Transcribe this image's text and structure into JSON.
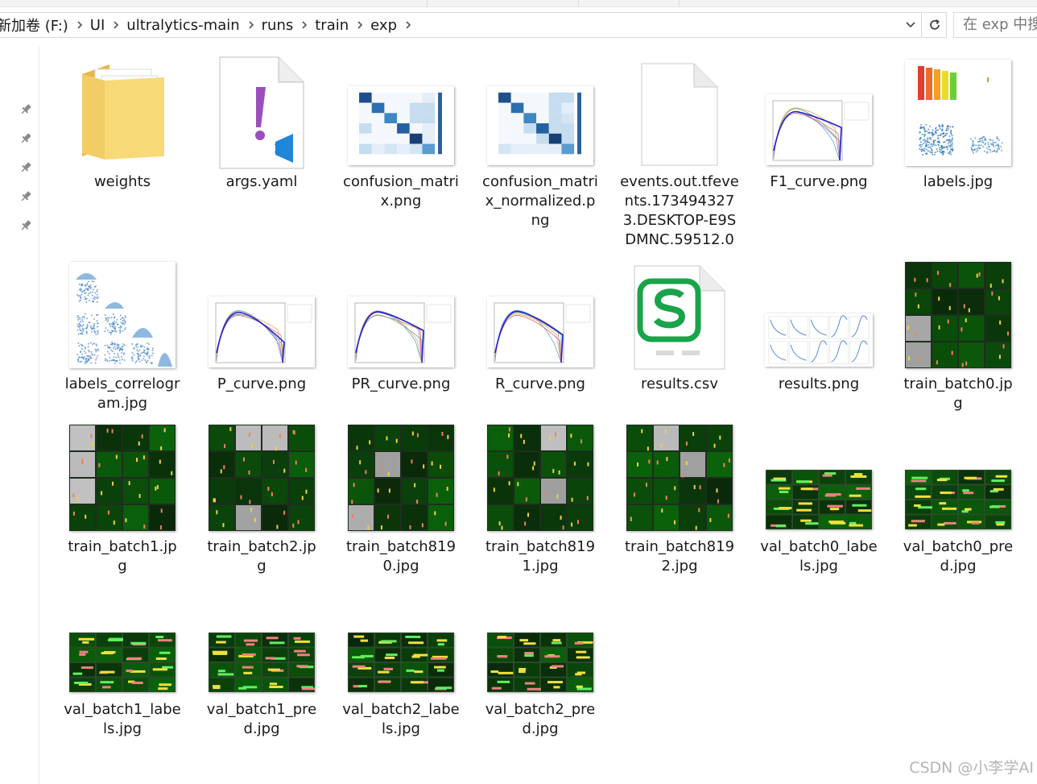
{
  "window": {
    "breadcrumb": [
      "新加卷 (F:)",
      "UI",
      "ultralytics-main",
      "runs",
      "train",
      "exp"
    ],
    "search_placeholder": "在 exp 中搜"
  },
  "nav": {
    "pins": [
      "pin-icon",
      "pin-icon",
      "pin-icon",
      "pin-icon",
      "pin-icon"
    ]
  },
  "files": [
    {
      "name": "weights",
      "type": "folder",
      "icon": "folder-icon"
    },
    {
      "name": "args.yaml",
      "type": "yaml",
      "icon": "vscode-yaml-icon"
    },
    {
      "name": "confusion_matrix.png",
      "type": "image",
      "icon": "confusion-matrix-thumb"
    },
    {
      "name": "confusion_matrix_normalized.png",
      "type": "image",
      "icon": "confusion-matrix-thumb"
    },
    {
      "name": "events.out.tfevents.1734943273.DESKTOP-E9SDMNC.59512.0",
      "type": "file",
      "icon": "blank-file-icon"
    },
    {
      "name": "F1_curve.png",
      "type": "image",
      "icon": "curve-thumb"
    },
    {
      "name": "labels.jpg",
      "type": "image",
      "icon": "labels-thumb"
    },
    {
      "name": "labels_correlogram.jpg",
      "type": "image",
      "icon": "correlogram-thumb"
    },
    {
      "name": "P_curve.png",
      "type": "image",
      "icon": "curve-thumb"
    },
    {
      "name": "PR_curve.png",
      "type": "image",
      "icon": "curve-thumb"
    },
    {
      "name": "R_curve.png",
      "type": "image",
      "icon": "curve-thumb"
    },
    {
      "name": "results.csv",
      "type": "csv",
      "icon": "wps-spreadsheet-icon"
    },
    {
      "name": "results.png",
      "type": "image",
      "icon": "results-thumb"
    },
    {
      "name": "train_batch0.jpg",
      "type": "image",
      "icon": "mosaic-thumb"
    },
    {
      "name": "train_batch1.jpg",
      "type": "image",
      "icon": "mosaic-thumb"
    },
    {
      "name": "train_batch2.jpg",
      "type": "image",
      "icon": "mosaic-thumb"
    },
    {
      "name": "train_batch8190.jpg",
      "type": "image",
      "icon": "mosaic-thumb"
    },
    {
      "name": "train_batch8191.jpg",
      "type": "image",
      "icon": "mosaic-thumb"
    },
    {
      "name": "train_batch8192.jpg",
      "type": "image",
      "icon": "mosaic-thumb"
    },
    {
      "name": "val_batch0_labels.jpg",
      "type": "image",
      "icon": "val-thumb"
    },
    {
      "name": "val_batch0_pred.jpg",
      "type": "image",
      "icon": "val-thumb"
    },
    {
      "name": "val_batch1_labels.jpg",
      "type": "image",
      "icon": "val-thumb"
    },
    {
      "name": "val_batch1_pred.jpg",
      "type": "image",
      "icon": "val-thumb"
    },
    {
      "name": "val_batch2_labels.jpg",
      "type": "image",
      "icon": "val-thumb"
    },
    {
      "name": "val_batch2_pred.jpg",
      "type": "image",
      "icon": "val-thumb"
    }
  ],
  "watermark": "CSDN @小李学AI"
}
